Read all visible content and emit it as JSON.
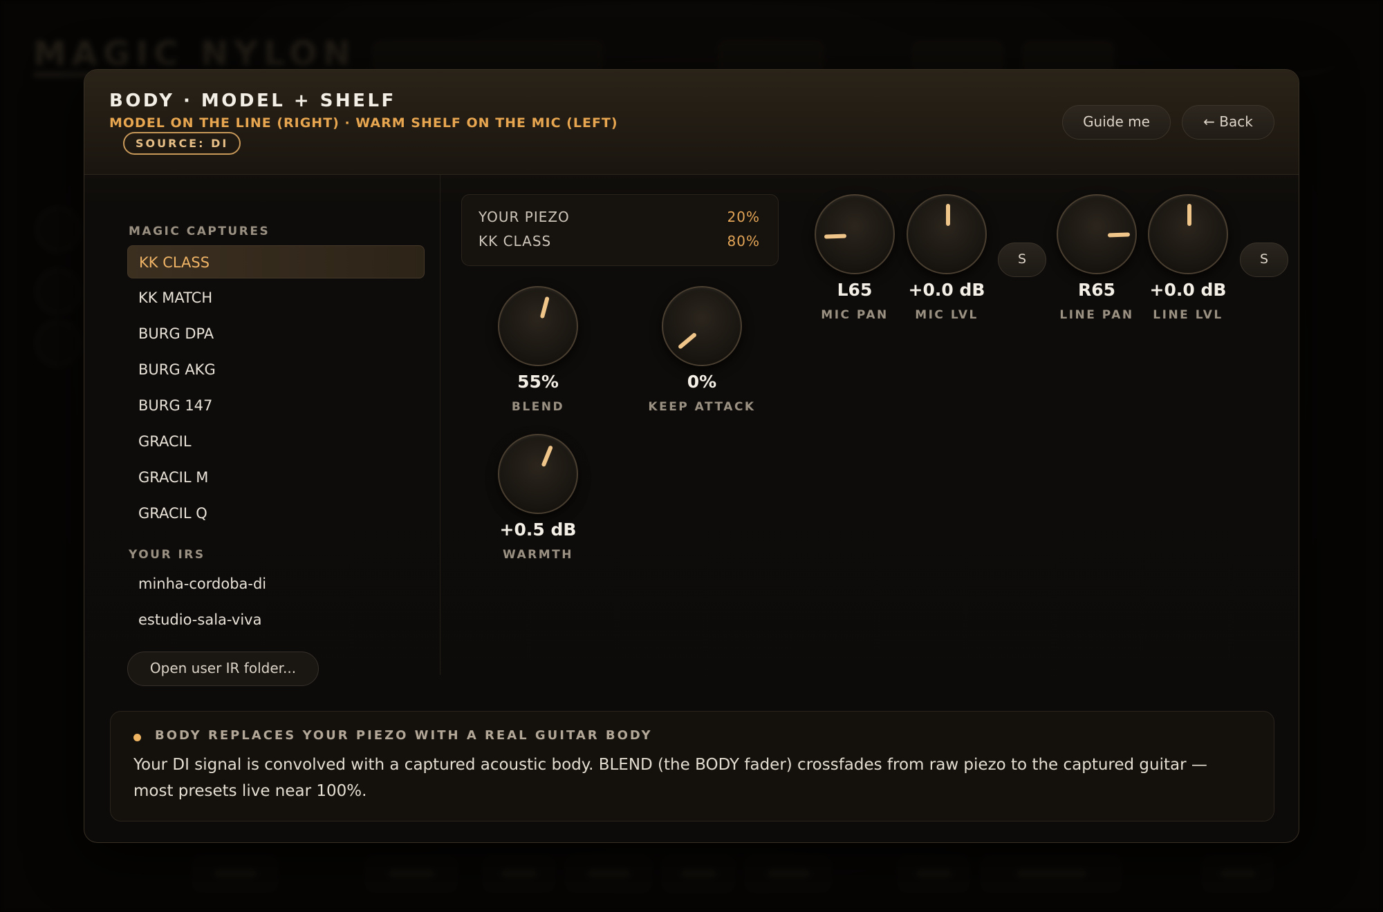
{
  "background": {
    "app_title": "MAGIC NYLON"
  },
  "modal": {
    "title": "BODY · MODEL + SHELF",
    "subtitle": "MODEL ON THE LINE (RIGHT) · WARM SHELF ON THE MIC (LEFT)",
    "source_badge": "SOURCE: DI",
    "guide_button": "Guide me",
    "back_button": "← Back"
  },
  "sidebar": {
    "captures_label": "MAGIC CAPTURES",
    "captures": [
      {
        "label": "KK CLASS",
        "active": true
      },
      {
        "label": "KK MATCH"
      },
      {
        "label": "BURG DPA"
      },
      {
        "label": "BURG AKG"
      },
      {
        "label": "BURG 147"
      },
      {
        "label": "GRACIL"
      },
      {
        "label": "GRACIL M"
      },
      {
        "label": "GRACIL Q"
      }
    ],
    "irs_label": "YOUR IRS",
    "irs": [
      {
        "label": "minha-cordoba-di"
      },
      {
        "label": "estudio-sala-viva"
      }
    ],
    "open_folder_button": "Open user IR folder..."
  },
  "mix": {
    "rows": [
      {
        "label": "YOUR PIEZO",
        "value": "20%"
      },
      {
        "label": "KK CLASS",
        "value": "80%"
      }
    ]
  },
  "knobs": {
    "blend": {
      "value": "55%",
      "label": "BLEND",
      "angle_deg": 15
    },
    "keep_attack": {
      "value": "0%",
      "label": "KEEP ATTACK",
      "angle_deg": -130
    },
    "warmth": {
      "value": "+0.5 dB",
      "label": "WARMTH",
      "angle_deg": 22
    },
    "mic_pan": {
      "value": "L65",
      "label": "MIC PAN",
      "angle_deg": -92
    },
    "mic_lvl": {
      "value": "+0.0 dB",
      "label": "MIC LVL",
      "angle_deg": 0
    },
    "line_pan": {
      "value": "R65",
      "label": "LINE PAN",
      "angle_deg": 88
    },
    "line_lvl": {
      "value": "+0.0 dB",
      "label": "LINE LVL",
      "angle_deg": 0
    }
  },
  "solo_buttons": {
    "mic": "S",
    "line": "S"
  },
  "info": {
    "heading": "BODY REPLACES YOUR PIEZO WITH A REAL GUITAR BODY",
    "text": "Your DI signal is convolved with a captured acoustic body. BLEND (the BODY fader) crossfades from raw piezo to the captured guitar — most presets live near 100%."
  },
  "colors": {
    "accent": "#e7a64f",
    "text": "#f4efe6",
    "muted": "#9b9183",
    "panel": "#14110d"
  }
}
